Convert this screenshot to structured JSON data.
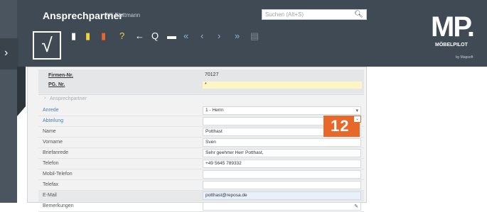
{
  "header": {
    "title": "Ansprechpartner",
    "user": "Uli Flottmann",
    "search_placeholder": "Suchen (Alt+S)"
  },
  "logo": {
    "mark": "MP.",
    "name": "MÖBELPILOT",
    "sub": "by Mapsoft"
  },
  "toolbar": {
    "save": "√",
    "icons": [
      {
        "name": "new-record-icon",
        "glyph": "▮",
        "color": "#ffffff"
      },
      {
        "name": "copy-record-icon",
        "glyph": "▮",
        "color": "#f3d23a"
      },
      {
        "name": "delete-icon",
        "glyph": "▮",
        "color": "#e8682a"
      },
      {
        "name": "help-icon",
        "glyph": "?",
        "color": "#f3d23a"
      },
      {
        "name": "back-icon",
        "glyph": "←",
        "color": "#ffffff"
      },
      {
        "name": "search-icon",
        "glyph": "Q",
        "color": "#ffffff"
      },
      {
        "name": "print-icon",
        "glyph": "▬",
        "color": "#ffffff"
      },
      {
        "name": "first-record-icon",
        "glyph": "«",
        "color": "#7fb7e8"
      },
      {
        "name": "previous-record-icon",
        "glyph": "‹",
        "color": "#7fb7e8"
      },
      {
        "name": "next-record-icon",
        "glyph": "›",
        "color": "#7fb7e8"
      },
      {
        "name": "last-record-icon",
        "glyph": "»",
        "color": "#7fb7e8"
      },
      {
        "name": "list-icon",
        "glyph": "▤",
        "color": "#7f8a94"
      }
    ]
  },
  "record": {
    "firm_label": "Firmen-Nr.",
    "firm_value": "70127",
    "p_label": "PG. Nr.",
    "p_value": "*"
  },
  "section_title": "Ansprechpartner",
  "fields": [
    {
      "label": "Anrede",
      "value": "1 - Herrn",
      "link": true,
      "select": true
    },
    {
      "label": "Abteilung",
      "value": "",
      "link": true,
      "select": false
    },
    {
      "label": "Name",
      "value": "Potthast",
      "link": false
    },
    {
      "label": "Vorname",
      "value": "Sven",
      "link": false
    },
    {
      "label": "Briefanrede",
      "value": "Sehr geehrter Herr Potthast,",
      "link": false
    },
    {
      "label": "Telefon",
      "value": "+49 5645 789332",
      "link": false
    },
    {
      "label": "Mobil-Telefon",
      "value": "",
      "link": false
    },
    {
      "label": "Telefax",
      "value": "",
      "link": false
    },
    {
      "label": "E-Mail",
      "value": "potthast@reposa.de",
      "link": false
    },
    {
      "label": "Bemerkungen",
      "value": "",
      "link": false
    }
  ],
  "marker": "12",
  "colors": {
    "header": "#3f4a55",
    "accent": "#e8682a",
    "field_yellow": "#fdf6c4"
  }
}
